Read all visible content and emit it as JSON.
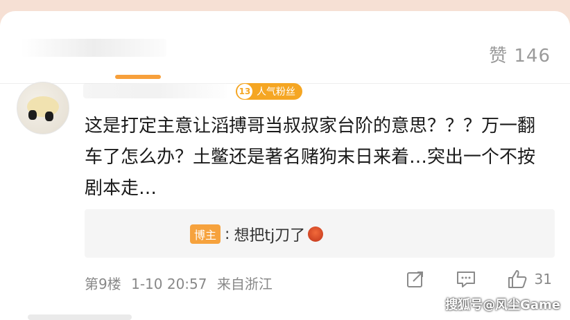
{
  "header": {
    "likes_label": "赞 146"
  },
  "comment": {
    "fan_level": "13",
    "fan_label": "人气粉丝",
    "text": "这是打定主意让滔搏哥当叔叔家台阶的意思？？？万一翻车了怎么办？土鳖还是著名赌狗末日来着…突出一个不按剧本走…",
    "floor": "第9楼",
    "datetime": "1-10 20:57",
    "location": "来自浙江",
    "like_count": "31"
  },
  "reply": {
    "author_tag": "博主",
    "separator": ":",
    "text": "想把tj刀了"
  },
  "watermark": "搜狐号@风尘Game",
  "colors": {
    "accent": "#f7a03b",
    "badge": "#f5a623"
  }
}
